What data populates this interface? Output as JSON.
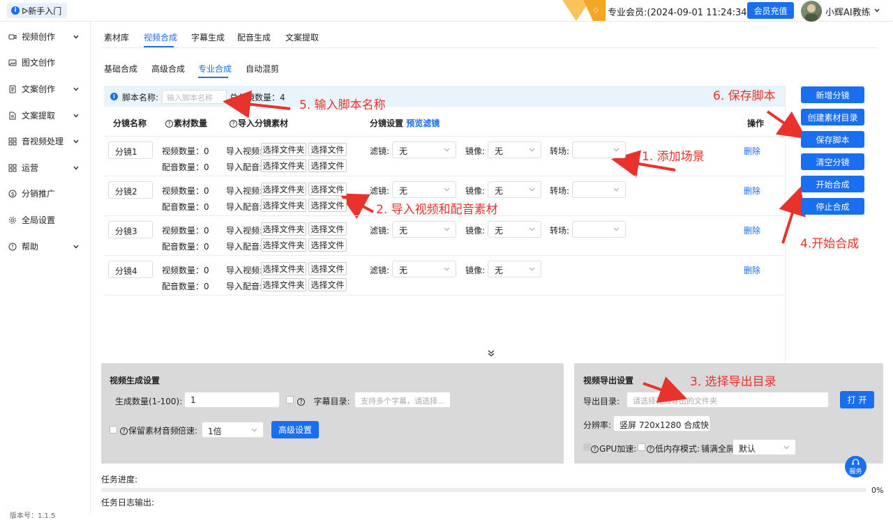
{
  "header": {
    "guide_label": "ᐅ新手入门",
    "member_text": "专业会员:(2024-09-01 11:24:34)",
    "recharge_label": "会员充值",
    "user_name": "小辉AI教练"
  },
  "sidebar": {
    "items": [
      {
        "label": "视频创作",
        "icon": "video-icon",
        "expandable": true
      },
      {
        "label": "图文创作",
        "icon": "image-icon",
        "expandable": false
      },
      {
        "label": "文案创作",
        "icon": "document-icon",
        "expandable": true
      },
      {
        "label": "文案提取",
        "icon": "file-extract-icon",
        "expandable": true
      },
      {
        "label": "音视频处理",
        "icon": "grid-icon",
        "expandable": true
      },
      {
        "label": "运营",
        "icon": "grid-icon",
        "expandable": true
      },
      {
        "label": "分销推广",
        "icon": "dollar-icon",
        "expandable": false
      },
      {
        "label": "全局设置",
        "icon": "gear-icon",
        "expandable": false
      },
      {
        "label": "帮助",
        "icon": "help-icon",
        "expandable": true
      }
    ],
    "version": "版本号：1.1.5"
  },
  "main_tabs": [
    {
      "label": "素材库",
      "active": false
    },
    {
      "label": "视频合成",
      "active": true
    },
    {
      "label": "字幕生成",
      "active": false
    },
    {
      "label": "配音生成",
      "active": false
    },
    {
      "label": "文案提取",
      "active": false
    }
  ],
  "sub_tabs": [
    {
      "label": "基础合成",
      "active": false
    },
    {
      "label": "高级合成",
      "active": false
    },
    {
      "label": "专业合成",
      "active": true
    },
    {
      "label": "自动混剪",
      "active": false
    }
  ],
  "script_bar": {
    "name_label": "脚本名称:",
    "name_placeholder": "输入脚本名称",
    "total_label": "总分镜数量：4"
  },
  "table": {
    "headers": {
      "name": "分镜名称",
      "material_count": "素材数量",
      "import_material": "导入分镜素材",
      "settings": "分镜设置",
      "preview_filter": "预览滤镜",
      "actions": "操作"
    },
    "video_count_label": "视频数量：",
    "audio_count_label": "配音数量：",
    "import_video_label": "导入视频:",
    "import_audio_label": "导入配音:",
    "choose_folder": "选择文件夹",
    "choose_file": "选择文件",
    "filter_label": "滤镜:",
    "mirror_label": "镜像:",
    "transition_label": "转场:",
    "delete_label": "删除",
    "rows": [
      {
        "name": "分镜1",
        "video_count": "0",
        "audio_count": "0",
        "filter": "无",
        "mirror": "无",
        "transition": ""
      },
      {
        "name": "分镜2",
        "video_count": "0",
        "audio_count": "0",
        "filter": "无",
        "mirror": "无",
        "transition": ""
      },
      {
        "name": "分镜3",
        "video_count": "0",
        "audio_count": "0",
        "filter": "无",
        "mirror": "无",
        "transition": ""
      },
      {
        "name": "分镜4",
        "video_count": "0",
        "audio_count": "0",
        "filter": "无",
        "mirror": "无"
      }
    ]
  },
  "right_buttons": [
    "新增分镜",
    "创建素材目录",
    "保存脚本",
    "清空分镜",
    "开始合成",
    "停止合成"
  ],
  "gen_panel": {
    "title": "视频生成设置",
    "count_label": "生成数量(1-100):",
    "count_value": "1",
    "subtitle_label": "字幕目录:",
    "subtitle_placeholder": "支持多个字幕，请选择...",
    "keep_audio_label": "保留素材音频",
    "speed_label": "倍速:",
    "speed_value": "1倍",
    "advanced_label": "高级设置"
  },
  "export_panel": {
    "title": "视频导出设置",
    "dir_label": "导出目录:",
    "dir_placeholder": "请选择视频导出的文件夹",
    "open_label": "打 开",
    "resolution_label": "分辨率:",
    "resolution_value": "竖屏 720x1280 合成快",
    "gpu_label": "GPU加速:",
    "low_mem_label": "低内存模式:",
    "fill_label": "铺满全屏:",
    "fill_value": "默认"
  },
  "progress": {
    "label": "任务进度:",
    "value": 0,
    "percent_text": "0%"
  },
  "log_label": "任务日志输出:",
  "service_label": "服务",
  "annotations": [
    "1. 添加场景",
    "2. 导入视频和配音素材",
    "3. 选择导出目录",
    "4.开始合成",
    "5. 输入脚本名称",
    "6. 保存脚本"
  ],
  "colors": {
    "accent": "#1a6ff0",
    "annotation": "#e8322b",
    "panel_bg": "#d9d9d9",
    "info_bar": "#e8f3fc"
  }
}
